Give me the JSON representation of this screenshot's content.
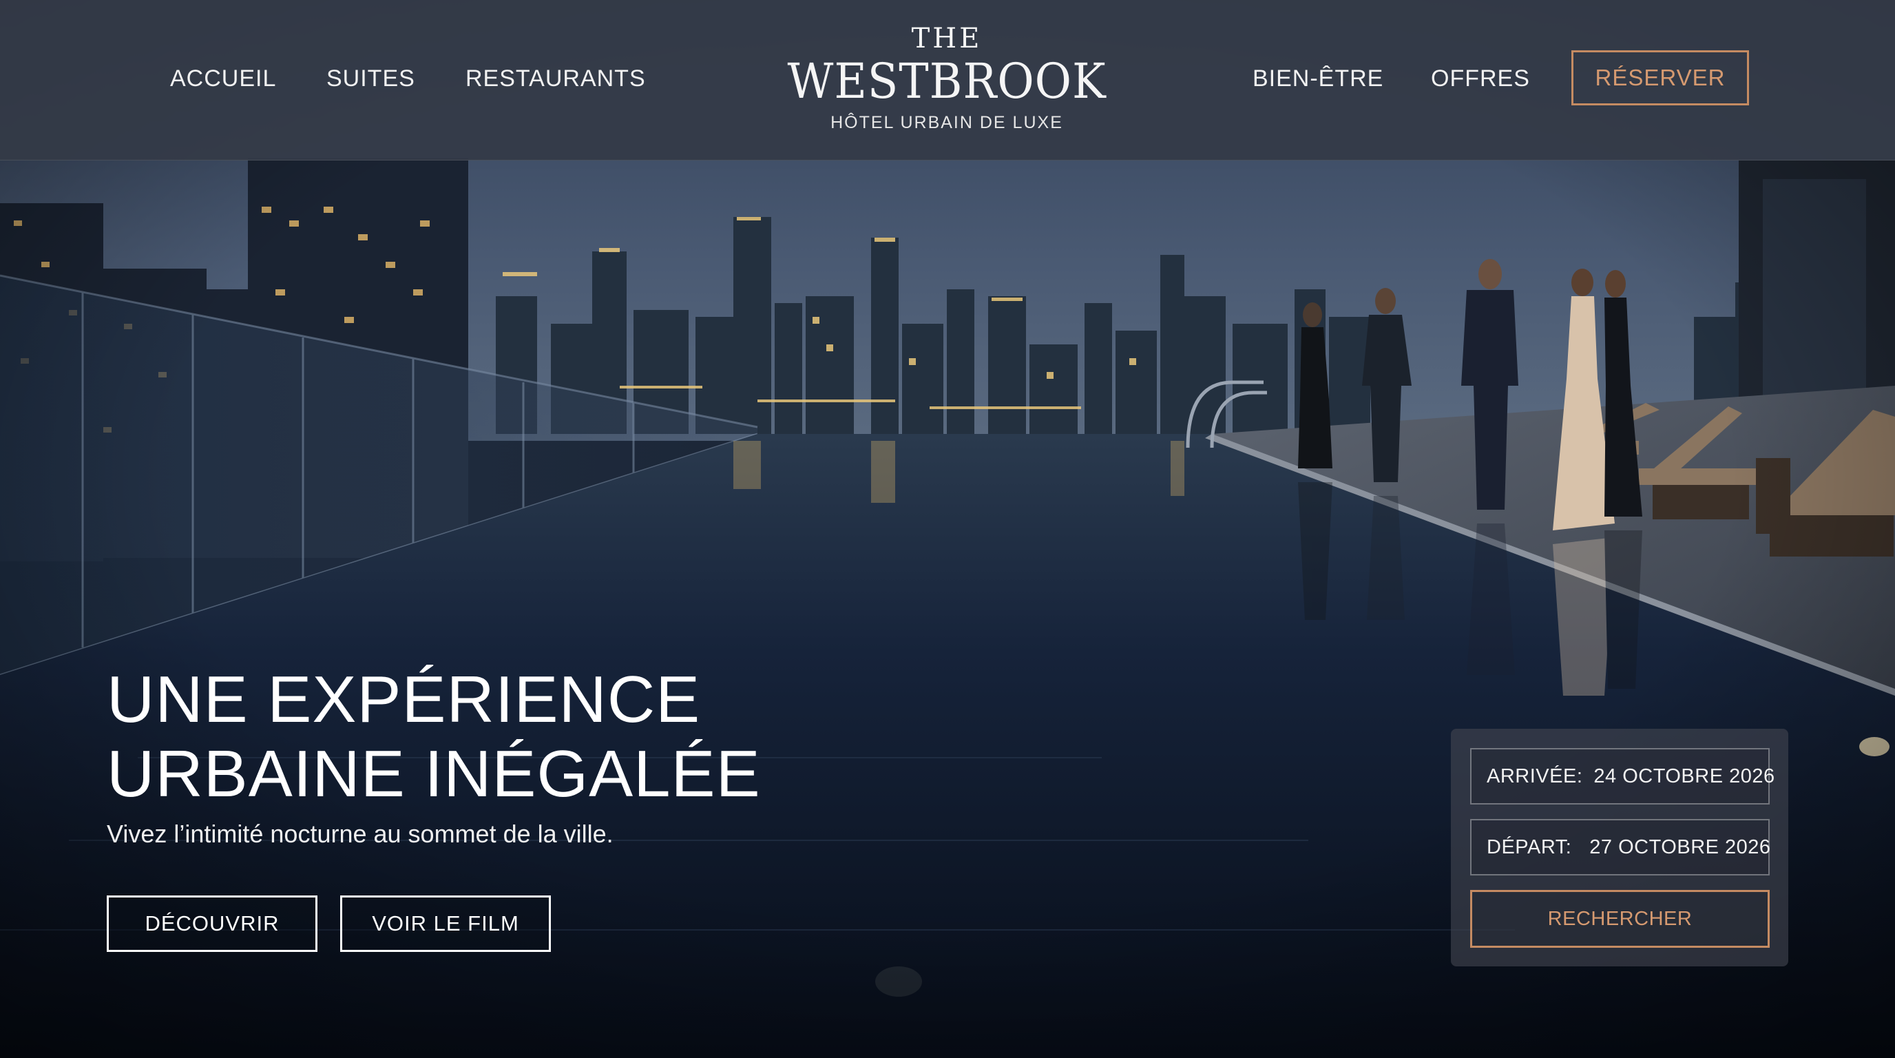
{
  "header": {
    "nav_left": [
      "ACCUEIL",
      "SUITES",
      "RESTAURANTS"
    ],
    "nav_right": [
      "BIEN-ÊTRE",
      "OFFRES"
    ],
    "logo": {
      "the": "THE",
      "name": "WESTBROOK",
      "tagline": "HÔTEL URBAIN DE LUXE"
    },
    "reserve_label": "RÉSERVER"
  },
  "hero": {
    "title_line1": "UNE EXPÉRIENCE",
    "title_line2": "URBAINE INÉGALÉE",
    "subtitle": "Vivez l’intimité nocturne au sommet de la ville.",
    "buttons": {
      "discover": "DÉCOUVRIR",
      "film": "VOIR LE FILM"
    }
  },
  "booking": {
    "arrival_label": "ARRIVÉE:",
    "arrival_value": "24 OCTOBRE 2026",
    "departure_label": "DÉPART:",
    "departure_value": "27 OCTOBRE 2026",
    "search_label": "RECHERCHER"
  },
  "colors": {
    "accent_copper": "#c58b62",
    "header_bg": "#343a47",
    "night_sky": "#3b4c66",
    "pool_water": "#101a28"
  }
}
